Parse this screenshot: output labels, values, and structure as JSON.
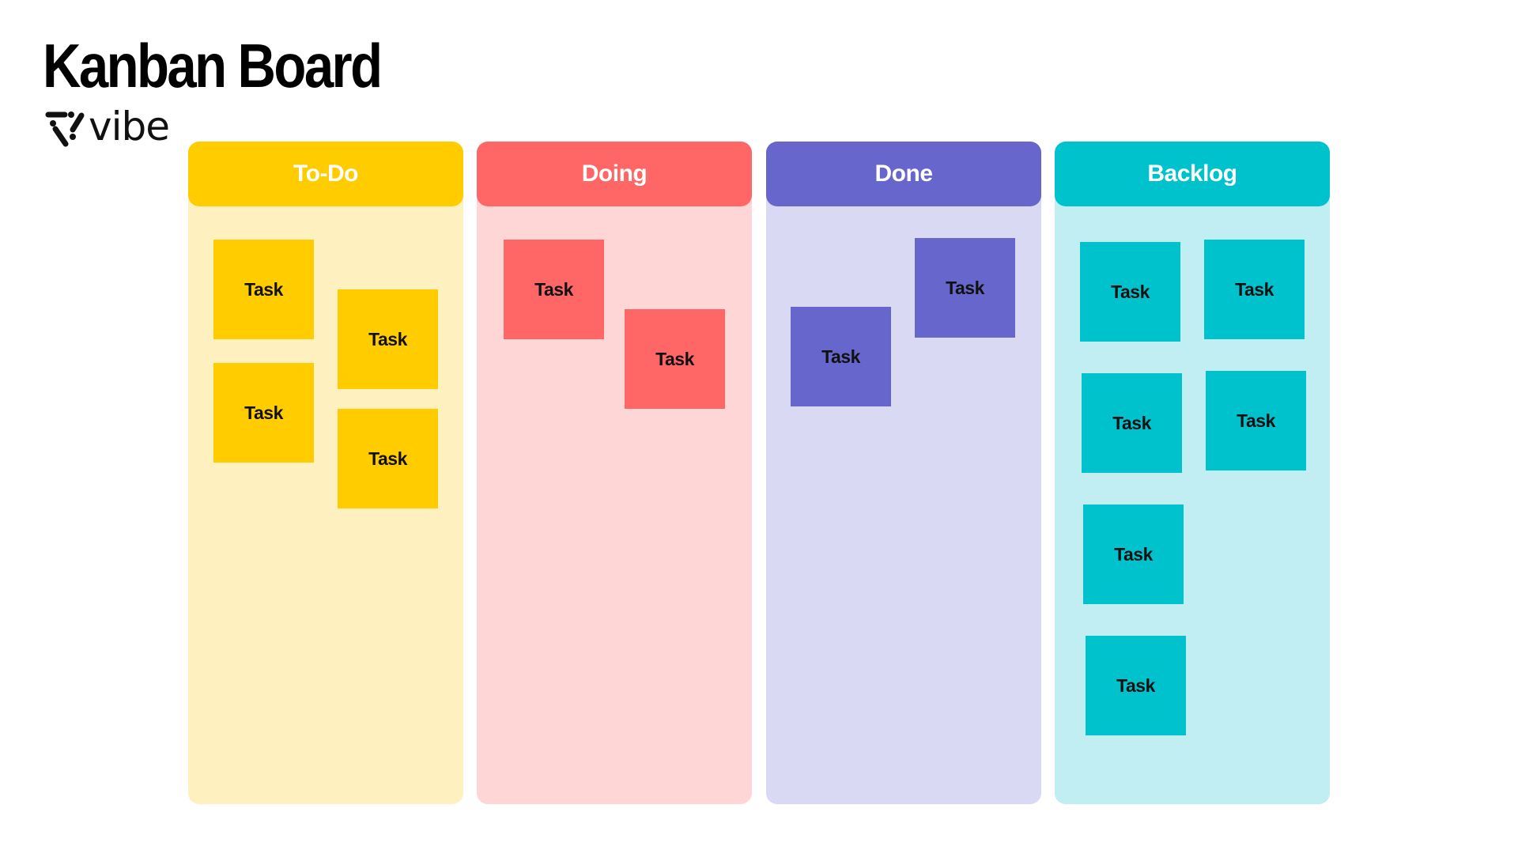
{
  "title": "Kanban Board",
  "brand": {
    "name": "vibe",
    "icon": "vibe-logo-icon"
  },
  "colors": {
    "todo": {
      "header": "#FFCC00",
      "body": "#FFF0C0"
    },
    "doing": {
      "header": "#FF6666",
      "body": "#FFD6D6"
    },
    "done": {
      "header": "#6666CC",
      "body": "#D9D9F3"
    },
    "backlog": {
      "header": "#00C2CC",
      "body": "#C0EEF2"
    }
  },
  "columns": [
    {
      "id": "todo",
      "label": "To-Do",
      "tasks": [
        "Task",
        "Task",
        "Task",
        "Task"
      ]
    },
    {
      "id": "doing",
      "label": "Doing",
      "tasks": [
        "Task",
        "Task"
      ]
    },
    {
      "id": "done",
      "label": "Done",
      "tasks": [
        "Task",
        "Task"
      ]
    },
    {
      "id": "backlog",
      "label": "Backlog",
      "tasks": [
        "Task",
        "Task",
        "Task",
        "Task",
        "Task",
        "Task"
      ]
    }
  ]
}
